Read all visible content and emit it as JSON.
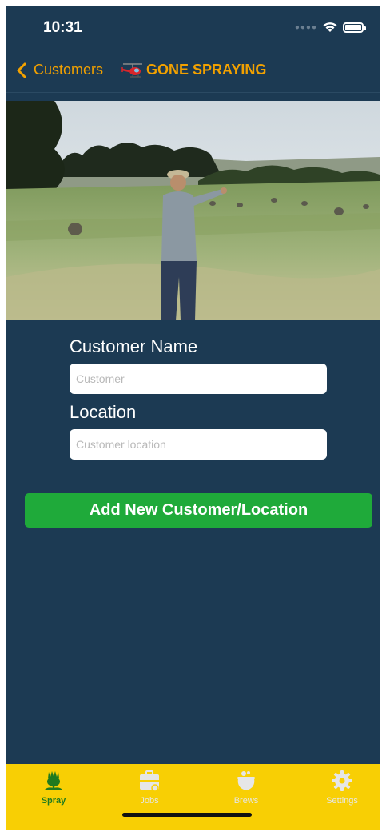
{
  "status_bar": {
    "time": "10:31"
  },
  "nav": {
    "back_label": "Customers",
    "title": "GONE SPRAYING",
    "back_icon": "chevron-left-icon",
    "logo_icon": "helicopter-icon"
  },
  "hero_image": {
    "description_icon": "photo"
  },
  "form": {
    "customer_name_label": "Customer Name",
    "customer_name_placeholder": "Customer",
    "customer_name_value": "",
    "location_label": "Location",
    "location_placeholder": "Customer location",
    "location_value": ""
  },
  "add_button_label": "Add New Customer/Location",
  "tabs": [
    {
      "label": "Spray",
      "icon": "thistle-icon",
      "active": true
    },
    {
      "label": "Jobs",
      "icon": "briefcase-icon",
      "active": false
    },
    {
      "label": "Brews",
      "icon": "cauldron-icon",
      "active": false
    },
    {
      "label": "Settings",
      "icon": "gear-icon",
      "active": false
    }
  ],
  "colors": {
    "background": "#1c3a53",
    "accent": "#f2a100",
    "button": "#1faa3a",
    "tab_bar": "#f8cf04",
    "tab_active": "#1f7a1f",
    "tab_inactive": "#e6e6e6"
  }
}
